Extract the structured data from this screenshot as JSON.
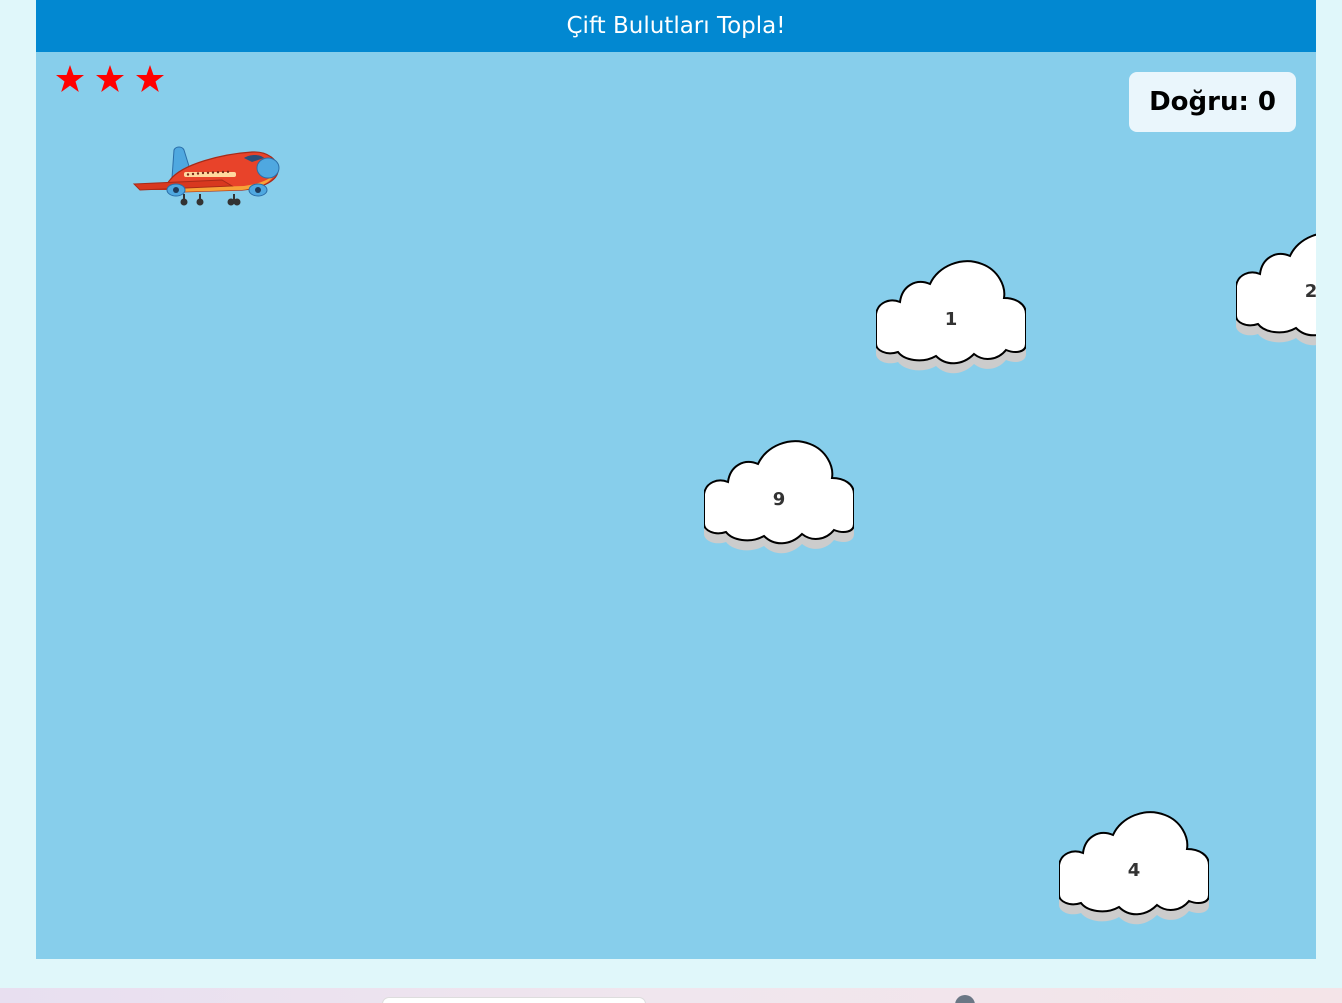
{
  "game": {
    "title": "Çift Bulutları Topla!",
    "score_text": "Doğru: 0",
    "lives": 3,
    "icons": {
      "life": "star-icon",
      "player": "airplane-icon",
      "target": "cloud-icon"
    },
    "colors": {
      "header": "#0288d1",
      "sky": "#87ceeb",
      "page_background": "#e0f7fa",
      "star": "#ff0000",
      "plane": "#e8432a",
      "cloud": "#ffffff"
    },
    "clouds": [
      {
        "number": "1"
      },
      {
        "number": "2"
      },
      {
        "number": "9"
      },
      {
        "number": "4"
      }
    ]
  }
}
